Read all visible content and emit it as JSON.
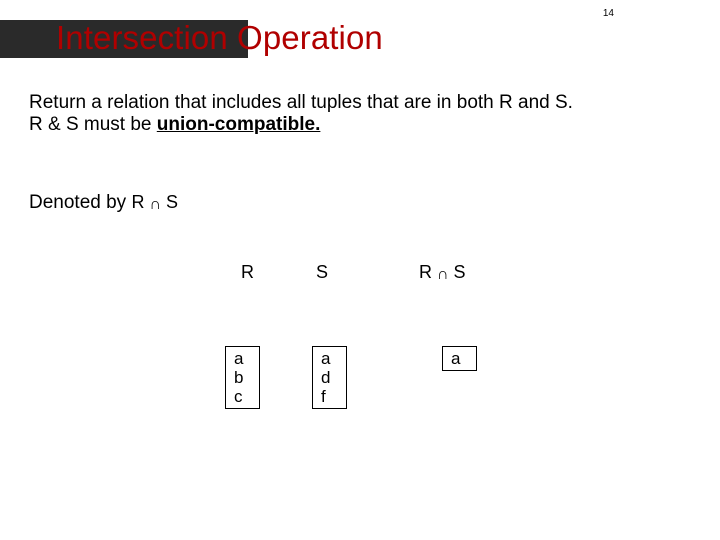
{
  "page_number": "14",
  "title": "Intersection Operation",
  "body": {
    "line1": "Return a relation that includes all tuples that are in both R and S.",
    "line2_prefix": "R & S must be ",
    "line2_emph": "union-compatible.",
    "denoted_prefix": "Denoted by  ",
    "denoted_expr_left": "R ",
    "denoted_expr_op": "∩",
    "denoted_expr_right": " S"
  },
  "labels": {
    "R": "R",
    "S": "S",
    "RS_left": "R ",
    "RS_op": "∩",
    "RS_right": " S"
  },
  "tables": {
    "R": [
      "a",
      "b",
      "c"
    ],
    "S": [
      "a",
      "d",
      "f"
    ],
    "RS": [
      "a"
    ]
  }
}
